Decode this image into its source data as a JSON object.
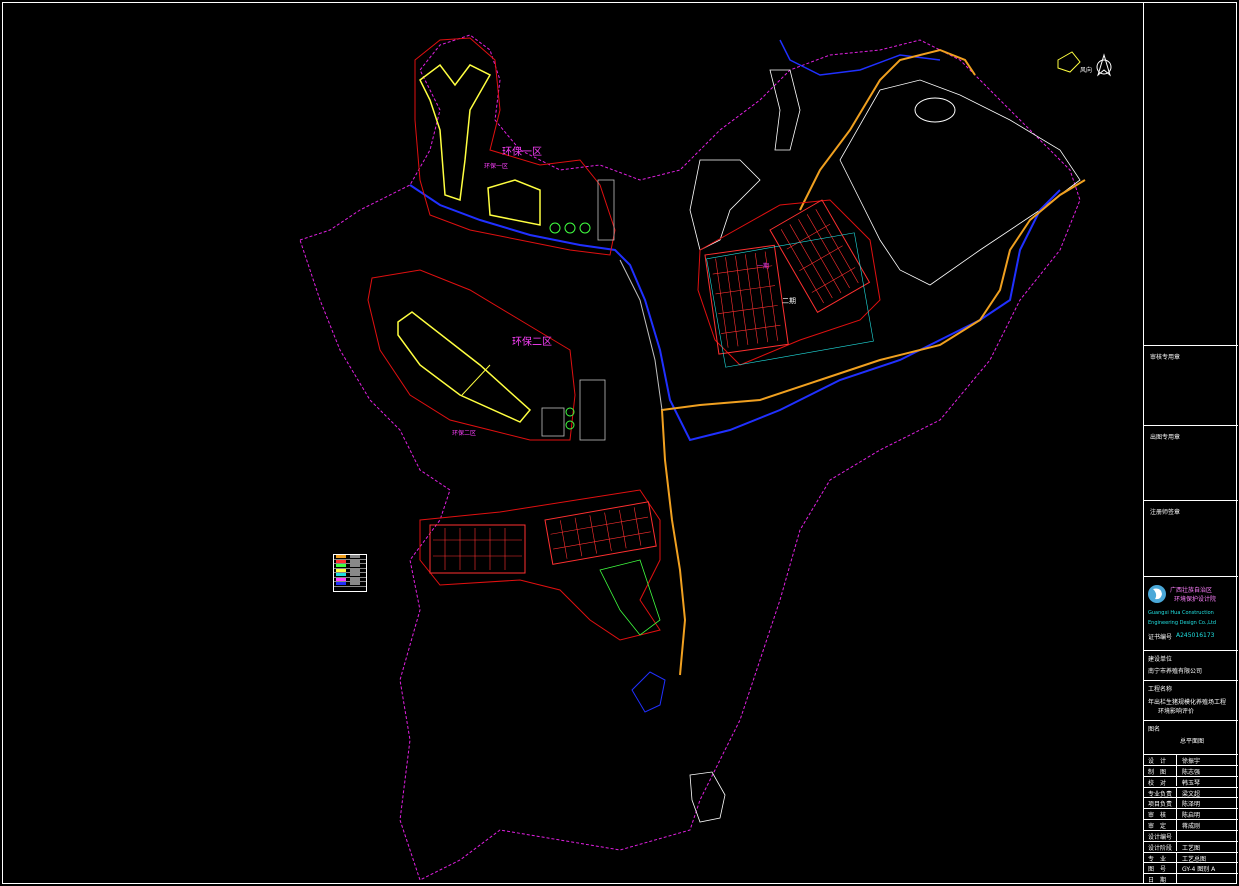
{
  "map": {
    "zone1_label": "环保一区",
    "zone1_sublabel": "环保一区",
    "zone2_label": "环保二区",
    "zone2_sublabel": "环保二区",
    "zone_north_label": "二期",
    "zone_north_sublabel": "一期",
    "compass_label": "N",
    "wind_label": "风向"
  },
  "title_block": {
    "section1": "审核专用章",
    "section2": "出图专用章",
    "section3": "注册师签章",
    "company_cn_line1": "广西壮族自治区",
    "company_cn_line2": "环境保护设计院",
    "company_en_line1": "Guangxi  Hua  Construction",
    "company_en_line2": "Engineering   Design   Co.,Ltd",
    "cert_label": "证书编号",
    "cert_no": "A245016173",
    "client_label": "建设单位",
    "client_name": "南宁市养殖有限公司",
    "project_label": "工程名称",
    "project_line1": "年出栏生猪规模化养殖场工程",
    "project_line2": "环境影响评价",
    "drawing_title_label": "图名",
    "drawing_title": "总平面图",
    "rows": [
      {
        "role": "设　计",
        "name": "徐振宇"
      },
      {
        "role": "制　图",
        "name": "陈志强"
      },
      {
        "role": "校　对",
        "name": "韩玉琴"
      },
      {
        "role": "专业负责",
        "name": "梁文超"
      },
      {
        "role": "项目负责",
        "name": "陈泽明"
      },
      {
        "role": "审　核",
        "name": "陈启明"
      },
      {
        "role": "审　定",
        "name": "蒋成刚"
      },
      {
        "role": "设计编号",
        "name": ""
      },
      {
        "role": "设计阶段",
        "name": "工艺图"
      },
      {
        "role": "专　业",
        "name": "工艺总图"
      },
      {
        "role": "图　号",
        "name": "GY-4   图别 A"
      },
      {
        "role": "日　期",
        "name": ""
      }
    ]
  },
  "colors": {
    "boundary": "#e020e0",
    "zone": "#e01010",
    "road": "#f0a020",
    "water": "#2030ff",
    "contour": "#ffffff",
    "building": "#ff3030",
    "highlight": "#ffff40",
    "label": "#ff40ff",
    "cyan": "#20e0e0"
  }
}
